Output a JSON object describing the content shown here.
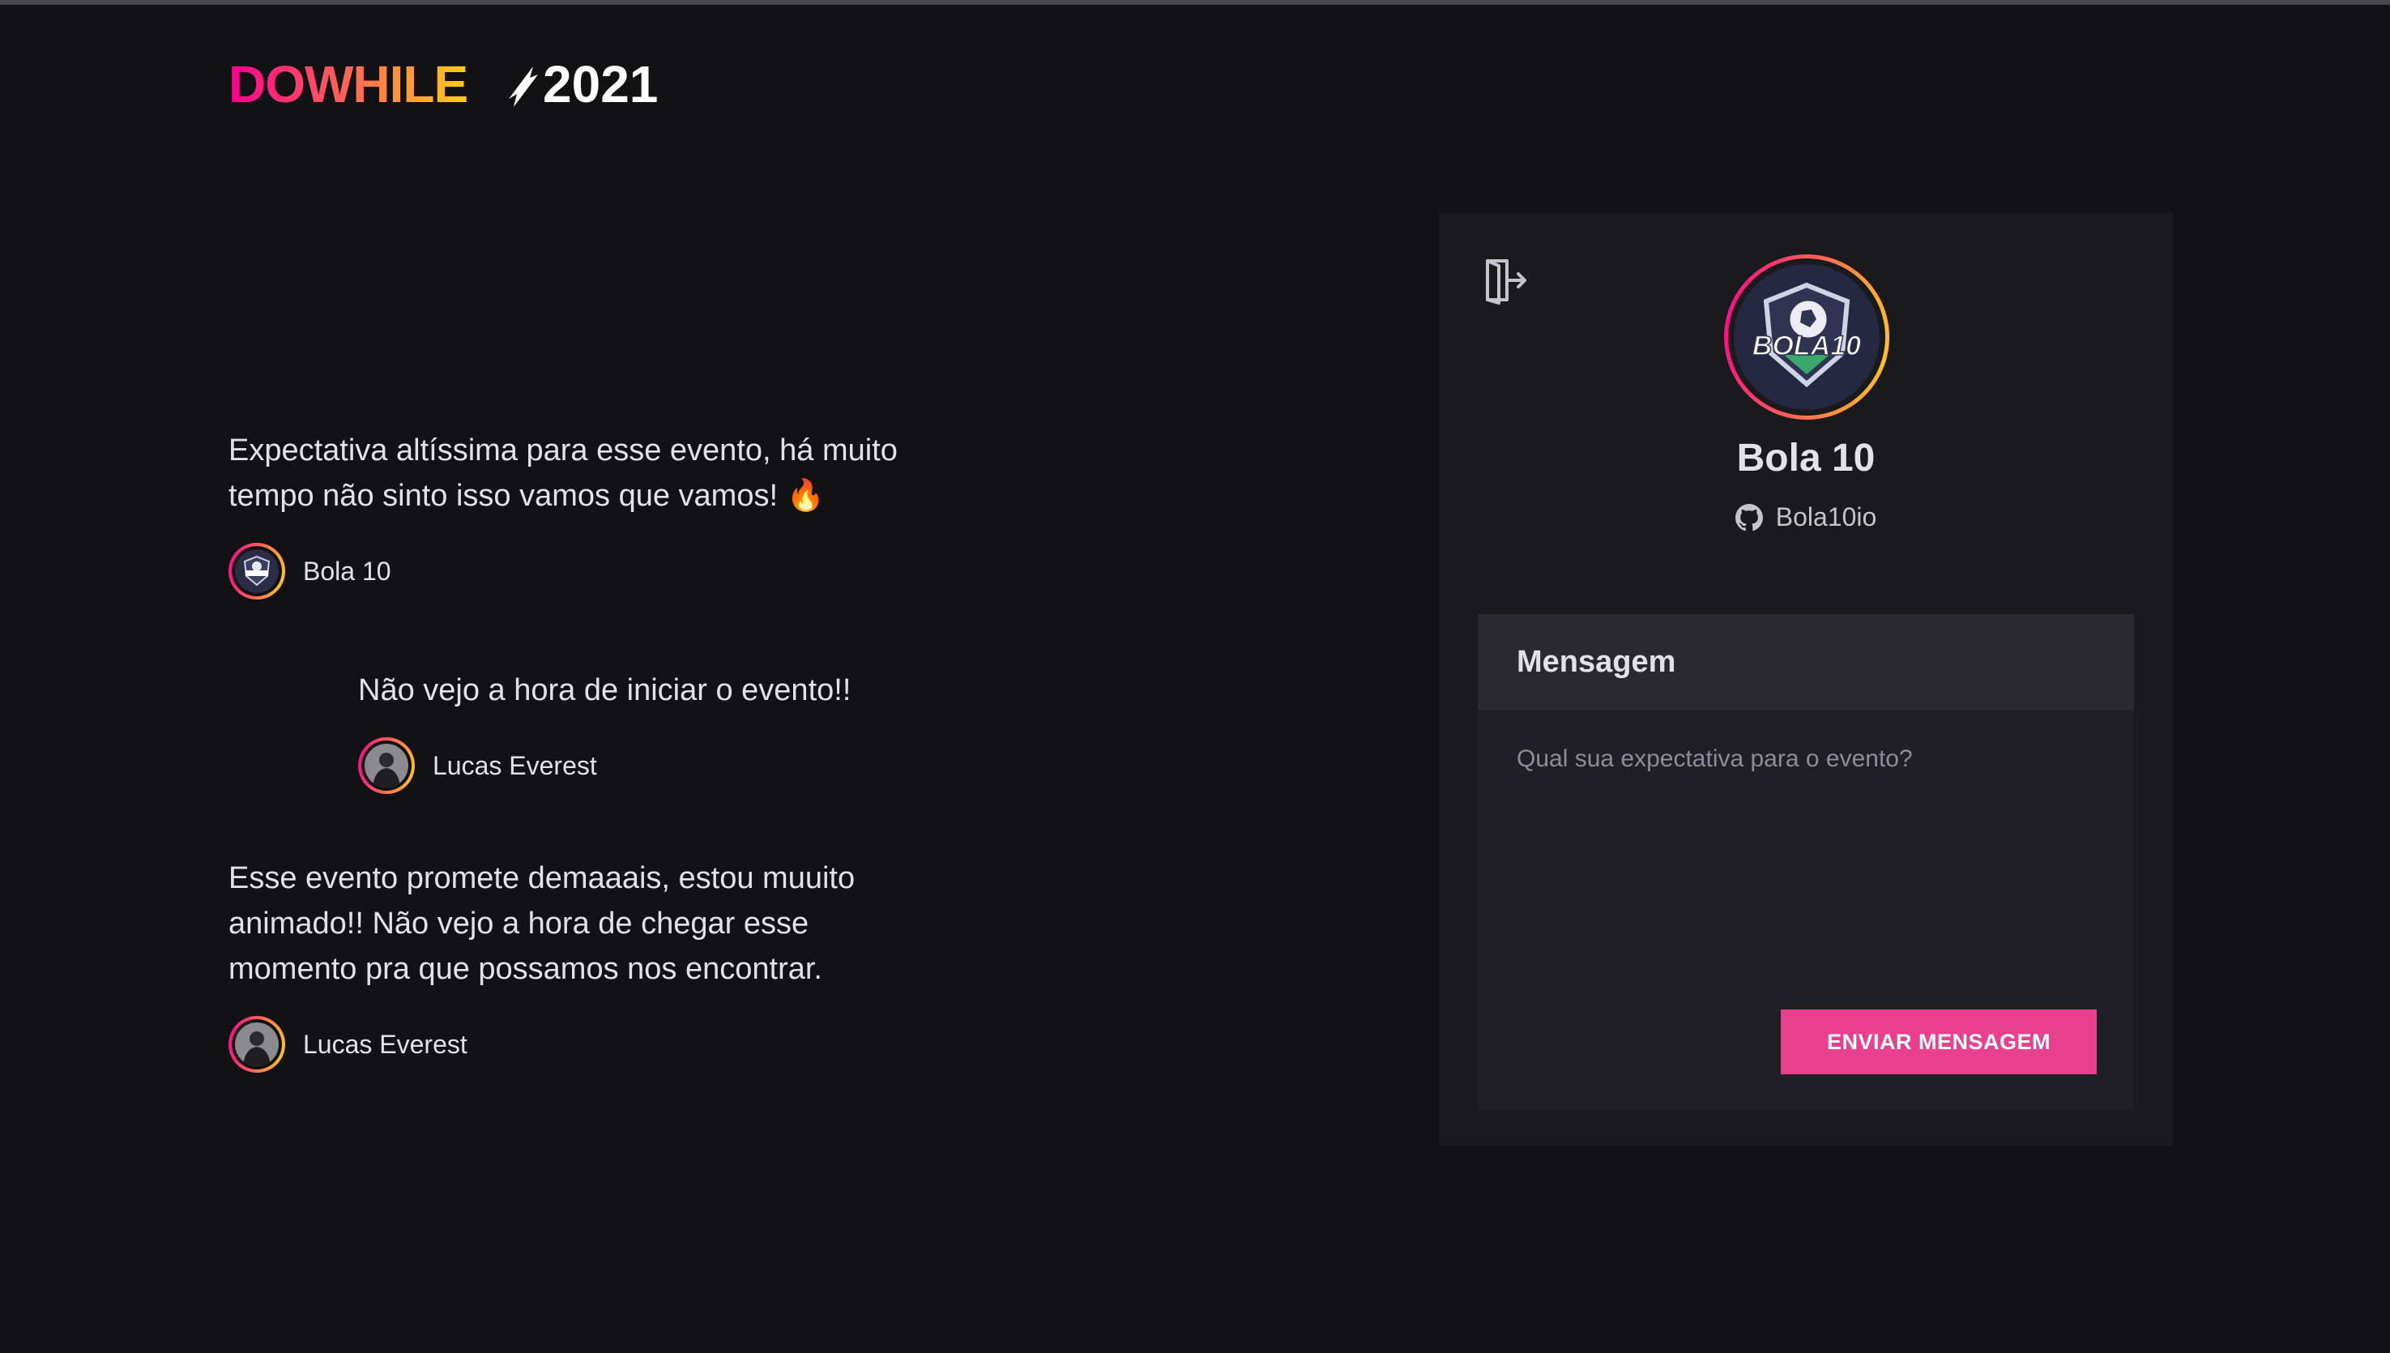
{
  "logo": {
    "brand_left": "DOWHILE",
    "brand_year": "2021",
    "gradient_start": "#ff008e",
    "gradient_end": "#ffcd1e"
  },
  "messages": [
    {
      "text": "Expectativa altíssima para esse evento, há muito\ntempo não sinto isso vamos que vamos! 🔥",
      "author": "Bola 10",
      "avatar_icon": "bola10-logo-icon"
    },
    {
      "text": "Não vejo a hora de iniciar o evento!!",
      "author": "Lucas Everest",
      "avatar_icon": "user-photo-icon"
    },
    {
      "text": "Esse evento promete demaaais, estou muuito\nanimado!! Não vejo a hora de chegar esse\nmomento pra que possamos nos encontrar.",
      "author": "Lucas Everest",
      "avatar_icon": "user-photo-icon"
    }
  ],
  "profile": {
    "name": "Bola 10",
    "github_login": "Bola10io",
    "github_icon": "github-icon",
    "signout_icon": "sign-out-icon"
  },
  "form": {
    "header_label": "Mensagem",
    "textarea_placeholder": "Qual sua expectativa para o evento?",
    "textarea_value": "",
    "send_label": "ENVIAR MENSAGEM",
    "send_color": "#e83f8f"
  },
  "colors": {
    "background": "#121214",
    "panel": "#1a1a1d",
    "form": "#202024",
    "form_header": "#29292e",
    "text": "#e1e1e6",
    "muted": "#8d8d99"
  }
}
